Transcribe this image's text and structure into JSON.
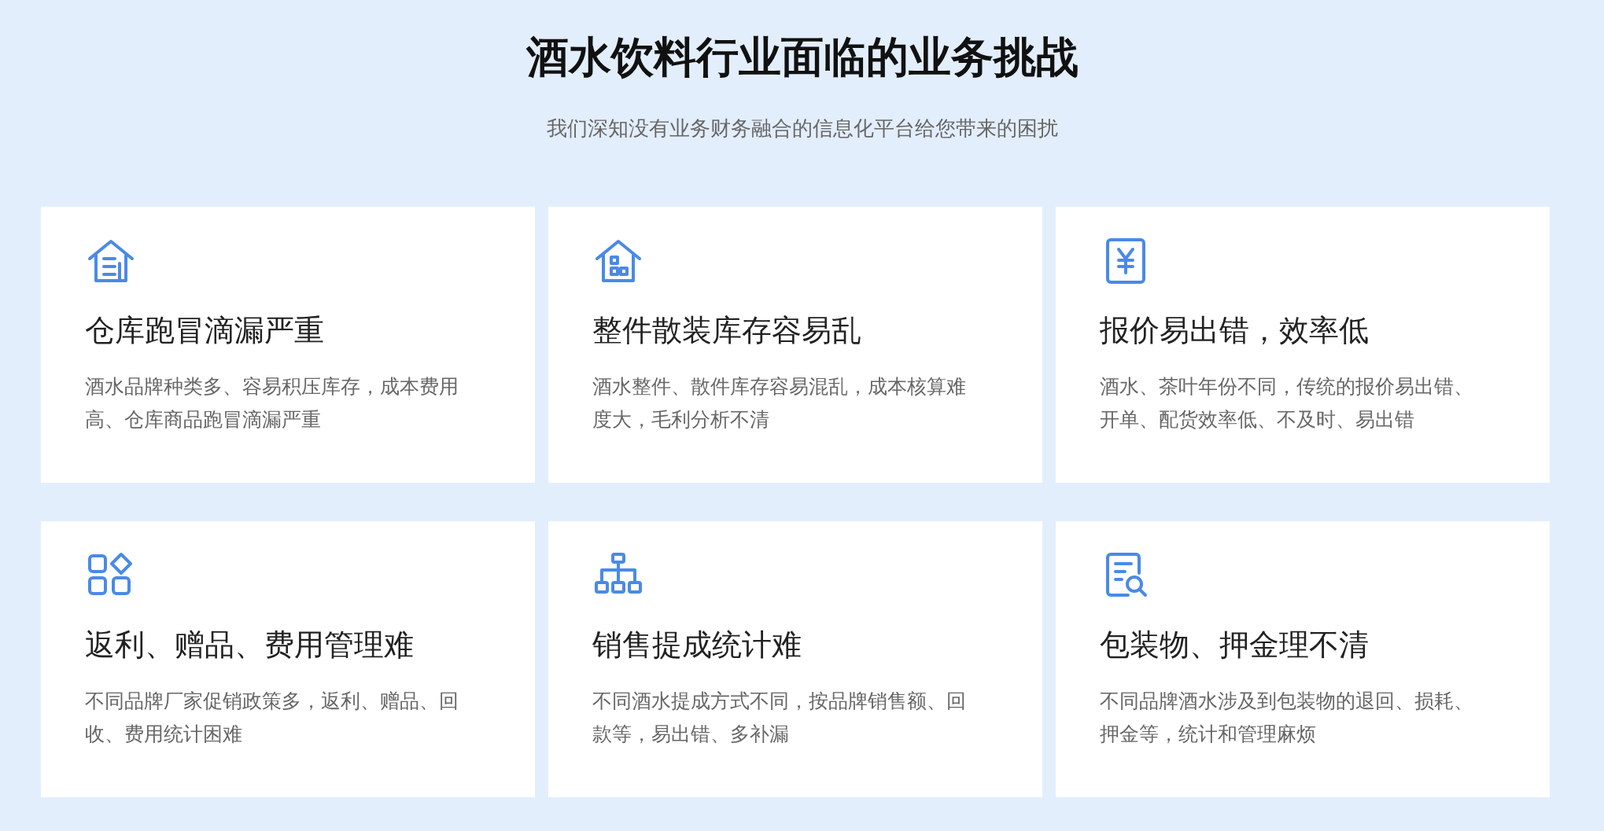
{
  "header": {
    "title": "酒水饮料行业面临的业务挑战",
    "subtitle": "我们深知没有业务财务融合的信息化平台给您带来的困扰"
  },
  "cards": [
    {
      "title": "仓库跑冒滴漏严重",
      "description": "酒水品牌种类多、容易积压库存，成本费用高、仓库商品跑冒滴漏严重"
    },
    {
      "title": "整件散装库存容易乱",
      "description": "酒水整件、散件库存容易混乱，成本核算难度大，毛利分析不清"
    },
    {
      "title": "报价易出错，效率低",
      "description": "酒水、茶叶年份不同，传统的报价易出错、开单、配货效率低、不及时、易出错"
    },
    {
      "title": "返利、赠品、费用管理难",
      "description": "不同品牌厂家促销政策多，返利、赠品、回收、费用统计困难"
    },
    {
      "title": "销售提成统计难",
      "description": "不同酒水提成方式不同，按品牌销售额、回款等，易出错、多补漏"
    },
    {
      "title": "包装物、押金理不清",
      "description": "不同品牌酒水涉及到包装物的退回、损耗、押金等，统计和管理麻烦"
    }
  ]
}
